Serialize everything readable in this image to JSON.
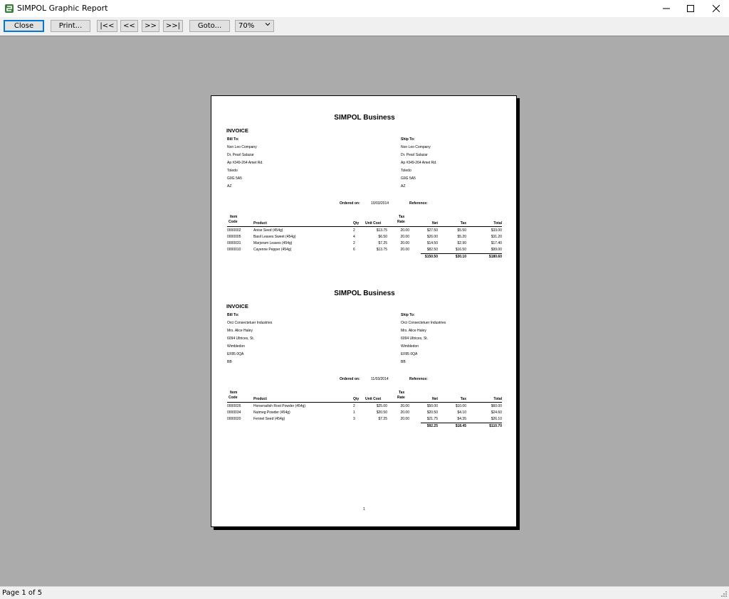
{
  "window": {
    "title": "SIMPOL Graphic Report",
    "icon": "simpol-app-icon",
    "controls": {
      "minimize": "—",
      "maximize": "☐",
      "close": "✕"
    }
  },
  "toolbar": {
    "close_label": "Close",
    "print_label": "Print...",
    "first_label": "|<<",
    "prev_label": "<<",
    "next_label": ">>",
    "last_label": ">>|",
    "goto_label": "Goto...",
    "zoom_value": "70%"
  },
  "report": {
    "invoices": [
      {
        "company": "SIMPOL Business",
        "heading": "INVOICE",
        "bill_to_label": "Bill To:",
        "ship_to_label": "Ship To:",
        "bill_to": [
          "Non Leo Company",
          "Dr. Pearl Salazar",
          "Ap #349-264 Amet Rd.",
          "Toledo",
          "G9G 5A5",
          "AZ"
        ],
        "ship_to": [
          "Non Leo Company",
          "Dr. Pearl Salazar",
          "Ap #349-264 Amet Rd.",
          "Toledo",
          "G9G 5A5",
          "AZ"
        ],
        "ordered_on_label": "Ordered on:",
        "ordered_on": "10/03/2014",
        "reference_label": "Reference:",
        "headers": {
          "item1": "Item",
          "item2": "Code",
          "product": "Product",
          "qty": "Qty",
          "unit_cost": "Unit Cost",
          "tax1": "Tax",
          "tax2": "Rate",
          "net": "Net",
          "tax": "Tax",
          "total": "Total"
        },
        "rows": [
          [
            "0000002",
            "Anise Seed (454g)",
            "2",
            "$13.75",
            "20.00",
            "$27.50",
            "$5.50",
            "$33.00"
          ],
          [
            "0000005",
            "Basil Leaves Sweet (454g)",
            "4",
            "$6.50",
            "20.00",
            "$26.00",
            "$5.20",
            "$31.20"
          ],
          [
            "0000031",
            "Marjoram Leaves (454g)",
            "2",
            "$7.25",
            "20.00",
            "$14.50",
            "$2.90",
            "$17.40"
          ],
          [
            "0000010",
            "Cayenne Pepper (454g)",
            "6",
            "$13.75",
            "20.00",
            "$82.50",
            "$16.50",
            "$99.00"
          ]
        ],
        "totals": {
          "net": "$150.50",
          "tax": "$30.10",
          "total": "$180.60"
        }
      },
      {
        "company": "SIMPOL Business",
        "heading": "INVOICE",
        "bill_to_label": "Bill To:",
        "ship_to_label": "Ship To:",
        "bill_to": [
          "Orci Consectetuer Industries",
          "Mrs. Alice Haley",
          "6094 Ultrices, St.",
          "Wimbledon",
          "EF85 0QA",
          "BB"
        ],
        "ship_to": [
          "Orci Consectetuer Industries",
          "Mrs. Alice Haley",
          "6094 Ultrices, St.",
          "Wimbledon",
          "EF85 0QA",
          "BB"
        ],
        "ordered_on_label": "Ordered on:",
        "ordered_on": "11/03/2014",
        "reference_label": "Reference:",
        "headers": {
          "item1": "Item",
          "item2": "Code",
          "product": "Product",
          "qty": "Qty",
          "unit_cost": "Unit Cost",
          "tax1": "Tax",
          "tax2": "Rate",
          "net": "Net",
          "tax": "Tax",
          "total": "Total"
        },
        "rows": [
          [
            "0000026",
            "Horseradish Root Powder (454g)",
            "2",
            "$25.00",
            "20.00",
            "$50.00",
            "$10.00",
            "$60.00"
          ],
          [
            "0000034",
            "Nutmeg Powder (454g)",
            "1",
            "$20.50",
            "20.00",
            "$20.50",
            "$4.10",
            "$24.60"
          ],
          [
            "0000020",
            "Fennel Seed (454g)",
            "3",
            "$7.25",
            "20.00",
            "$21.75",
            "$4.35",
            "$26.10"
          ]
        ],
        "totals": {
          "net": "$92.25",
          "tax": "$18.45",
          "total": "$110.70"
        }
      }
    ],
    "page_number": "1"
  },
  "status": {
    "text": "Page 1 of 5"
  },
  "colors": {
    "preview_bg": "#ababab",
    "toolbar_bg": "#f0f0f0",
    "focus_border": "#0078d7"
  }
}
